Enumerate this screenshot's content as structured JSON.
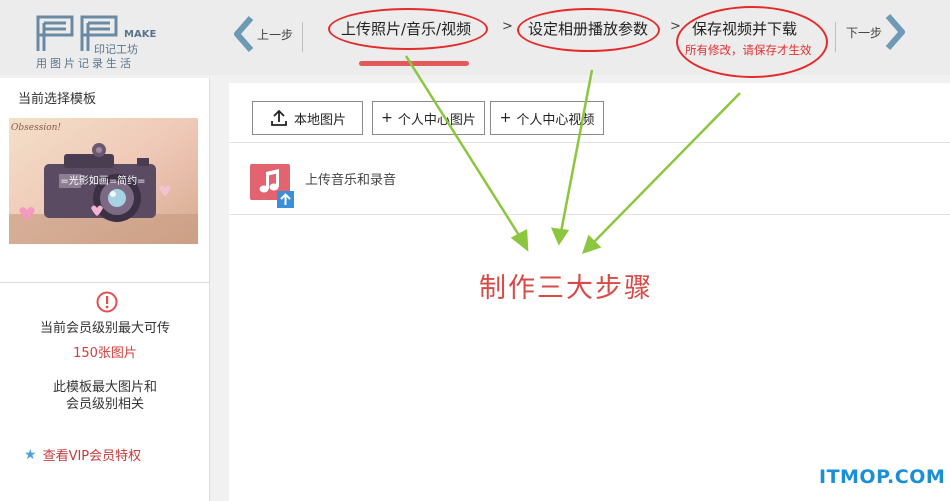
{
  "header": {
    "logo": {
      "letters": "PP",
      "make": "MAKE",
      "brand": "印记工坊",
      "tagline": "用图片记录生活"
    },
    "prev": {
      "label": "上一步",
      "icon": "chevron-left-icon"
    },
    "next": {
      "label": "下一步",
      "icon": "chevron-right-icon"
    },
    "steps": [
      {
        "label": "上传照片/音乐/视频",
        "active": true
      },
      {
        "label": "设定相册播放参数"
      },
      {
        "label": "保存视频并下载",
        "note": "所有修改，请保存才生效"
      }
    ],
    "separator": ">",
    "accent": "#e35a5a",
    "annotation_color": "#e52a2a"
  },
  "sidebar": {
    "title": "当前选择模板",
    "thumbnail": {
      "script_text": "Obsession!",
      "caption": "=光影如画=简约="
    },
    "warn_icon": "exclamation-circle-icon",
    "limit_line1": "当前会员级别最大可传",
    "limit_value": "150张图片",
    "note_line1": "此模板最大图片和",
    "note_line2": "会员级别相关",
    "vip_link": "查看VIP会员特权",
    "vip_icon": "star-icon"
  },
  "main": {
    "buttons": [
      {
        "label": "本地图片",
        "icon": "upload-icon"
      },
      {
        "label": "个人中心图片",
        "icon": "plus-icon"
      },
      {
        "label": "个人中心视频",
        "icon": "plus-icon"
      }
    ],
    "music": {
      "label": "上传音乐和录音",
      "icon": "music-note-icon"
    },
    "annotation": "制作三大步骤",
    "arrow_color": "#8cc63f"
  },
  "watermark": "ITMOP.COM"
}
